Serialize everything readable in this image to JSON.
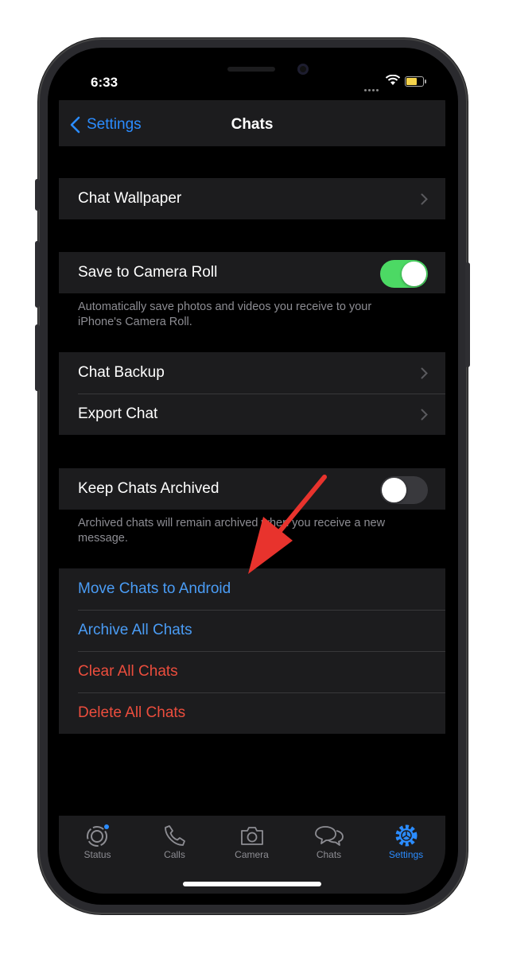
{
  "status_bar": {
    "time": "6:33"
  },
  "nav": {
    "back_label": "Settings",
    "title": "Chats"
  },
  "sections": {
    "wallpaper": {
      "label": "Chat Wallpaper"
    },
    "camera_roll": {
      "label": "Save to Camera Roll",
      "toggle_on": true,
      "footer": "Automatically save photos and videos you receive to your iPhone's Camera Roll."
    },
    "backup": {
      "chat_backup": "Chat Backup",
      "export_chat": "Export Chat"
    },
    "archived": {
      "label": "Keep Chats Archived",
      "toggle_on": false,
      "footer": "Archived chats will remain archived when you receive a new message."
    },
    "actions": {
      "move_to_android": "Move Chats to Android",
      "archive_all": "Archive All Chats",
      "clear_all": "Clear All Chats",
      "delete_all": "Delete All Chats"
    }
  },
  "tabs": [
    {
      "label": "Status",
      "icon": "status-icon"
    },
    {
      "label": "Calls",
      "icon": "phone-icon"
    },
    {
      "label": "Camera",
      "icon": "camera-icon"
    },
    {
      "label": "Chats",
      "icon": "chats-icon"
    },
    {
      "label": "Settings",
      "icon": "gear-icon",
      "active": true
    }
  ],
  "colors": {
    "accent_blue": "#2b8cff",
    "link_blue": "#4a9cf5",
    "destructive_red": "#eb4d3d",
    "toggle_green": "#4cd964",
    "annotation_arrow": "#e8332d"
  }
}
